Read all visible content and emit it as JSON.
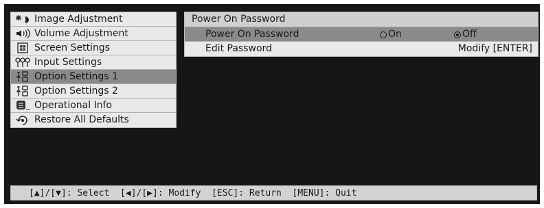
{
  "menu": {
    "items": [
      {
        "label": "Image Adjustment",
        "icon": "image-adjust-icon",
        "selected": false
      },
      {
        "label": "Volume Adjustment",
        "icon": "speaker-icon",
        "selected": false
      },
      {
        "label": "Screen Settings",
        "icon": "screen-icon",
        "selected": false
      },
      {
        "label": "Input Settings",
        "icon": "input-plugs-icon",
        "selected": false
      },
      {
        "label": "Option Settings 1",
        "icon": "wrench-settings-icon",
        "selected": true
      },
      {
        "label": "Option Settings 2",
        "icon": "wrench-settings-icon",
        "selected": false
      },
      {
        "label": "Operational Info",
        "icon": "info-list-icon",
        "selected": false
      },
      {
        "label": "Restore All Defaults",
        "icon": "restore-icon",
        "selected": false
      }
    ]
  },
  "panel": {
    "title": "Power On Password",
    "rows": [
      {
        "label": "Power On Password",
        "option_on": "On",
        "option_off": "Off",
        "selected_option": "Off"
      },
      {
        "label": "Edit Password",
        "action": "Modify [ENTER]"
      }
    ]
  },
  "statusbar": {
    "text": "[▲]/[▼]: Select  [◀]/[▶]: Modify  [ESC]: Return  [MENU]: Quit"
  }
}
